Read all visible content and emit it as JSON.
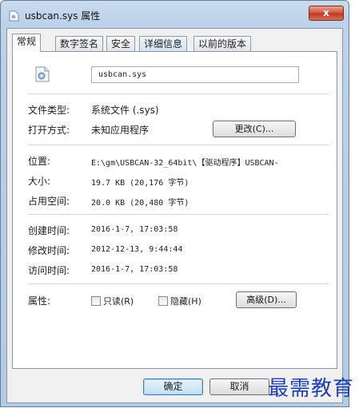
{
  "window": {
    "title": "usbcan.sys 属性",
    "close_label": "x"
  },
  "tabs": [
    {
      "label": "常规",
      "active": true
    },
    {
      "label": "数字签名",
      "active": false
    },
    {
      "label": "安全",
      "active": false
    },
    {
      "label": "详细信息",
      "active": false
    },
    {
      "label": "以前的版本",
      "active": false
    }
  ],
  "general": {
    "file_name": "usbcan.sys",
    "file_type_label": "文件类型:",
    "file_type_value": "系统文件 (.sys)",
    "open_with_label": "打开方式:",
    "open_with_value": "未知应用程序",
    "change_button": "更改(C)...",
    "location_label": "位置:",
    "location_value": "E:\\gm\\USBCAN-32_64bit\\【驱动程序】USBCAN-",
    "size_label": "大小:",
    "size_value": "19.7 KB (20,176 字节)",
    "size_on_disk_label": "占用空间:",
    "size_on_disk_value": "20.0 KB (20,480 字节)",
    "created_label": "创建时间:",
    "created_value": "2016-1-7, 17:03:58",
    "modified_label": "修改时间:",
    "modified_value": "2012-12-13, 9:44:44",
    "accessed_label": "访问时间:",
    "accessed_value": "2016-1-7, 17:03:58",
    "attributes_label": "属性:",
    "readonly_label": "只读(R)",
    "hidden_label": "隐藏(H)",
    "advanced_button": "高级(D)..."
  },
  "footer": {
    "ok_label": "确定",
    "cancel_label": "取消"
  },
  "watermark": "最需教育"
}
